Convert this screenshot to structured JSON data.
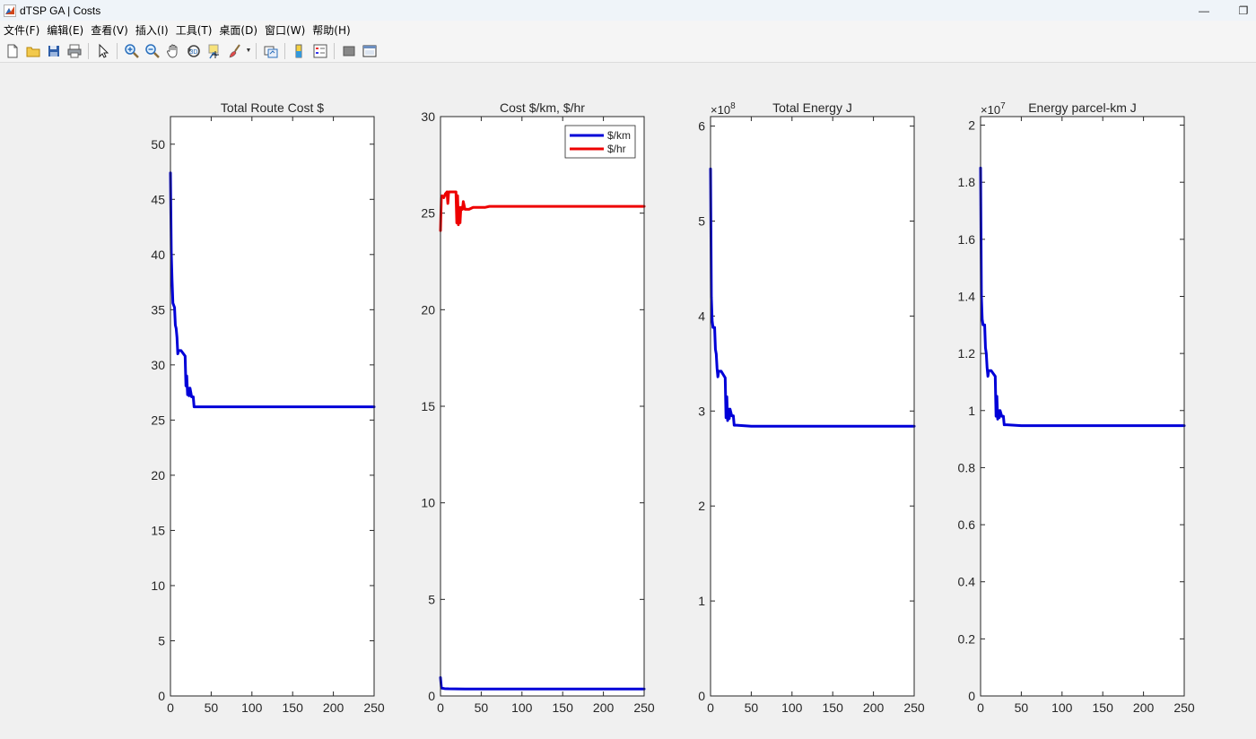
{
  "window": {
    "title": "dTSP GA | Costs",
    "minimize_glyph": "—",
    "restore_glyph": "❐"
  },
  "menu": [
    {
      "key": "file",
      "label": "文件(F)"
    },
    {
      "key": "edit",
      "label": "编辑(E)"
    },
    {
      "key": "view",
      "label": "查看(V)"
    },
    {
      "key": "insert",
      "label": "插入(I)"
    },
    {
      "key": "tools",
      "label": "工具(T)"
    },
    {
      "key": "desktop",
      "label": "桌面(D)"
    },
    {
      "key": "window",
      "label": "窗口(W)"
    },
    {
      "key": "help",
      "label": "帮助(H)"
    }
  ],
  "toolbar": [
    "new-figure-icon",
    "open-file-icon",
    "save-icon",
    "print-icon",
    "|",
    "select-arrow-icon",
    "|",
    "zoom-in-icon",
    "zoom-out-icon",
    "pan-hand-icon",
    "rotate-3d-icon",
    "data-cursor-icon",
    "brush-icon",
    "brush-dropdown",
    "|",
    "link-plot-icon",
    "|",
    "colorbar-icon",
    "legend-icon",
    "|",
    "hide-plot-tools-icon",
    "show-plot-tools-icon"
  ],
  "chart_data": [
    {
      "type": "line",
      "title": "Total Route Cost $",
      "xlim": [
        0,
        250
      ],
      "ylim": [
        0,
        52.5
      ],
      "xticks": [
        0,
        50,
        100,
        150,
        200,
        250
      ],
      "yticks": [
        0,
        5,
        10,
        15,
        20,
        25,
        30,
        35,
        40,
        45,
        50
      ],
      "exponent": "",
      "legend": null,
      "series": [
        {
          "color": "#0000d8",
          "x": [
            0,
            1,
            2,
            3,
            5,
            6,
            7,
            8,
            9,
            10,
            11,
            12,
            13,
            18,
            19,
            20,
            21,
            22,
            23,
            24,
            26,
            27,
            28,
            29,
            32,
            250
          ],
          "y": [
            47.4,
            40.2,
            37.6,
            35.6,
            35.2,
            33.6,
            33.3,
            32.5,
            31.0,
            31.3,
            31.3,
            31.3,
            31.3,
            30.8,
            28.1,
            29.0,
            27.3,
            27.9,
            27.2,
            27.9,
            27.1,
            27.1,
            27.1,
            26.2,
            26.2,
            26.2
          ]
        }
      ]
    },
    {
      "type": "line",
      "title": "Cost $/km, $/hr",
      "xlim": [
        0,
        250
      ],
      "ylim": [
        0,
        30
      ],
      "xticks": [
        0,
        50,
        100,
        150,
        200,
        250
      ],
      "yticks": [
        0,
        5,
        10,
        15,
        20,
        25,
        30
      ],
      "exponent": "",
      "legend": {
        "location": "top-right"
      },
      "series": [
        {
          "name": "$/km",
          "color": "#0000d8",
          "x": [
            0,
            1,
            2,
            5,
            10,
            30,
            60,
            250
          ],
          "y": [
            0.95,
            0.45,
            0.4,
            0.38,
            0.37,
            0.36,
            0.36,
            0.36
          ]
        },
        {
          "name": "$/hr",
          "color": "#ee0000",
          "x": [
            0,
            1,
            2,
            4,
            6,
            8,
            9,
            10,
            11,
            12,
            14,
            17,
            19,
            20,
            21,
            22,
            23,
            24,
            25,
            27,
            28,
            30,
            32,
            35,
            40,
            45,
            50,
            55,
            60,
            250
          ],
          "y": [
            24.1,
            25.8,
            25.9,
            25.8,
            26.0,
            26.1,
            25.5,
            26.1,
            26.1,
            26.1,
            26.1,
            26.1,
            26.1,
            24.5,
            25.9,
            24.4,
            25.3,
            24.5,
            25.3,
            25.2,
            25.6,
            25.2,
            25.2,
            25.2,
            25.3,
            25.3,
            25.3,
            25.3,
            25.35,
            25.35
          ]
        }
      ]
    },
    {
      "type": "line",
      "title": "Total Energy J",
      "xlim": [
        0,
        250
      ],
      "ylim": [
        0,
        6.1
      ],
      "xticks": [
        0,
        50,
        100,
        150,
        200,
        250
      ],
      "yticks": [
        0,
        1,
        2,
        3,
        4,
        5,
        6
      ],
      "exponent": "8",
      "legend": null,
      "series": [
        {
          "color": "#0000d8",
          "x": [
            0,
            1,
            2,
            3,
            5,
            6,
            7,
            8,
            9,
            10,
            11,
            12,
            13,
            18,
            19,
            20,
            21,
            22,
            23,
            24,
            26,
            27,
            28,
            29,
            32,
            50,
            250
          ],
          "y": [
            5.55,
            4.2,
            3.95,
            3.88,
            3.88,
            3.65,
            3.6,
            3.45,
            3.36,
            3.42,
            3.42,
            3.42,
            3.42,
            3.35,
            2.93,
            3.15,
            2.9,
            3.02,
            2.92,
            3.02,
            2.95,
            2.95,
            2.95,
            2.85,
            2.85,
            2.84,
            2.84
          ]
        }
      ]
    },
    {
      "type": "line",
      "title": "Energy parcel-km J",
      "xlim": [
        0,
        250
      ],
      "ylim": [
        0,
        2.03
      ],
      "xticks": [
        0,
        50,
        100,
        150,
        200,
        250
      ],
      "yticks": [
        0,
        0.2,
        0.4,
        0.6,
        0.8,
        1,
        1.2,
        1.4,
        1.6,
        1.8,
        2
      ],
      "exponent": "7",
      "legend": null,
      "series": [
        {
          "color": "#0000d8",
          "x": [
            0,
            1,
            2,
            3,
            5,
            6,
            7,
            8,
            9,
            10,
            11,
            12,
            13,
            18,
            19,
            20,
            21,
            22,
            23,
            24,
            26,
            27,
            28,
            29,
            32,
            50,
            250
          ],
          "y": [
            1.85,
            1.4,
            1.32,
            1.3,
            1.3,
            1.22,
            1.2,
            1.15,
            1.12,
            1.14,
            1.14,
            1.14,
            1.14,
            1.12,
            0.98,
            1.05,
            0.97,
            1.0,
            0.975,
            1.0,
            0.98,
            0.98,
            0.98,
            0.95,
            0.95,
            0.947,
            0.947
          ]
        }
      ]
    }
  ]
}
